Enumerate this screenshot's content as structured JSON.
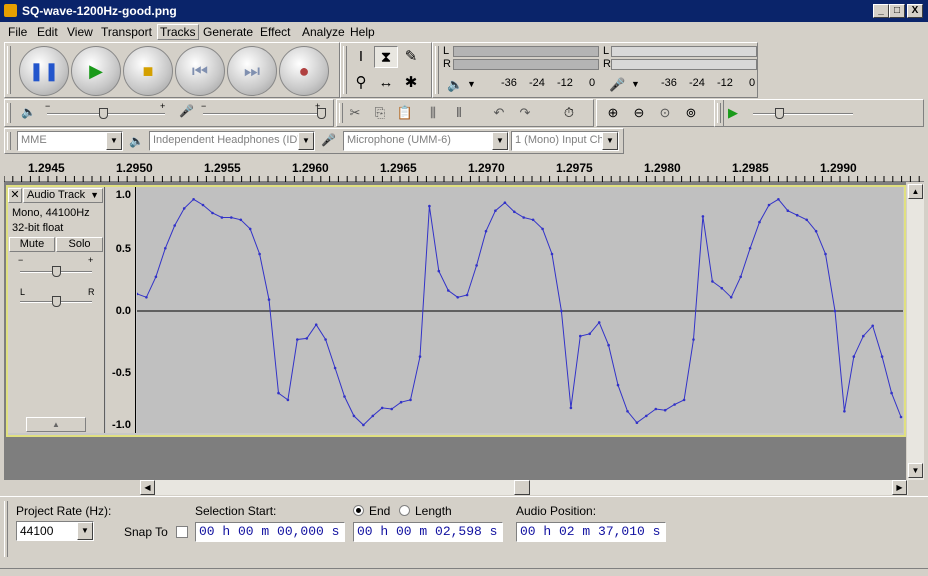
{
  "window": {
    "title": "SQ-wave-1200Hz-good.png",
    "min": "_",
    "max": "□",
    "close": "X"
  },
  "menu": [
    "File",
    "Edit",
    "View",
    "Transport",
    "Tracks",
    "Generate",
    "Effect",
    "Analyze",
    "Help"
  ],
  "transport": {
    "pause": "pause-icon",
    "play": "play-icon",
    "stop": "stop-icon",
    "skip_start": "skip-start-icon",
    "skip_end": "skip-end-icon",
    "record": "record-icon"
  },
  "meters": {
    "play_L": "L",
    "play_R": "R",
    "rec_L": "L",
    "rec_R": "R",
    "play_scale": [
      "-36",
      "-24",
      "-12",
      "0"
    ],
    "rec_scale": [
      "-36",
      "-24",
      "-12",
      "0"
    ]
  },
  "devices": {
    "host": "MME",
    "playback": "Independent Headphones (IDT",
    "recording": "Microphone (UMM-6)",
    "channels": "1 (Mono) Input Ch"
  },
  "ruler": [
    "1.2945",
    "1.2950",
    "1.2955",
    "1.2960",
    "1.2965",
    "1.2970",
    "1.2975",
    "1.2980",
    "1.2985",
    "1.2990"
  ],
  "track": {
    "name": "Audio Track",
    "info1": "Mono, 44100Hz",
    "info2": "32-bit float",
    "mute": "Mute",
    "solo": "Solo",
    "gain_minus": "−",
    "gain_plus": "+",
    "pan_L": "L",
    "pan_R": "R",
    "vscale": [
      "1.0",
      "0.5",
      "0.0",
      "-0.5",
      "-1.0"
    ]
  },
  "waveform": [
    0.15,
    0.12,
    0.3,
    0.55,
    0.75,
    0.9,
    0.98,
    0.93,
    0.86,
    0.82,
    0.82,
    0.8,
    0.72,
    0.5,
    0.1,
    -0.72,
    -0.78,
    -0.25,
    -0.24,
    -0.12,
    -0.25,
    -0.5,
    -0.75,
    -0.92,
    -1.0,
    -0.92,
    -0.85,
    -0.86,
    -0.8,
    -0.78,
    -0.4,
    0.92,
    0.35,
    0.18,
    0.12,
    0.14,
    0.4,
    0.7,
    0.88,
    0.95,
    0.87,
    0.82,
    0.8,
    0.72,
    0.5,
    0.0,
    -0.85,
    -0.22,
    -0.2,
    -0.1,
    -0.3,
    -0.65,
    -0.88,
    -0.98,
    -0.92,
    -0.86,
    -0.87,
    -0.82,
    -0.78,
    -0.25,
    0.83,
    0.26,
    0.2,
    0.12,
    0.3,
    0.55,
    0.78,
    0.93,
    0.98,
    0.88,
    0.84,
    0.8,
    0.7,
    0.5,
    0.0,
    -0.88,
    -0.4,
    -0.22,
    -0.13,
    -0.4,
    -0.72,
    -0.93
  ],
  "bottom": {
    "project_rate_label": "Project Rate (Hz):",
    "project_rate": "44100",
    "snap_label": "Snap To",
    "sel_start_label": "Selection Start:",
    "end_label": "End",
    "length_label": "Length",
    "audio_pos_label": "Audio Position:",
    "sel_start": "00 h 00 m 00,000 s",
    "sel_end": "00 h 00 m 02,598 s",
    "audio_pos": "00 h 02 m 37,010 s"
  }
}
